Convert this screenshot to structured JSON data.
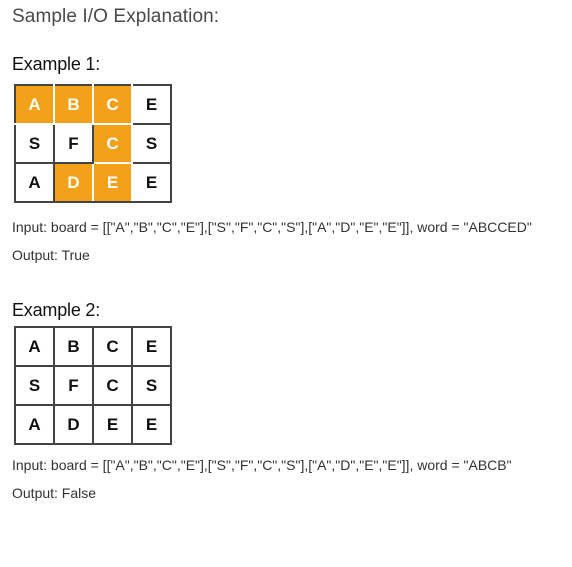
{
  "heading": "Sample I/O Explanation:",
  "examples": [
    {
      "title": "Example 1:",
      "board": [
        [
          "A",
          "B",
          "C",
          "E"
        ],
        [
          "S",
          "F",
          "C",
          "S"
        ],
        [
          "A",
          "D",
          "E",
          "E"
        ]
      ],
      "highlighted": [
        [
          0,
          0
        ],
        [
          0,
          1
        ],
        [
          0,
          2
        ],
        [
          1,
          2
        ],
        [
          2,
          1
        ],
        [
          2,
          2
        ]
      ],
      "highlight_color": "#f4a11a",
      "input": "Input: board = [[\"A\",\"B\",\"C\",\"E\"],[\"S\",\"F\",\"C\",\"S\"],[\"A\",\"D\",\"E\",\"E\"]], word = \"ABCCED\"",
      "output": "Output: True"
    },
    {
      "title": "Example 2:",
      "board": [
        [
          "A",
          "B",
          "C",
          "E"
        ],
        [
          "S",
          "F",
          "C",
          "S"
        ],
        [
          "A",
          "D",
          "E",
          "E"
        ]
      ],
      "highlighted": [],
      "input": "Input: board = [[\"A\",\"B\",\"C\",\"E\"],[\"S\",\"F\",\"C\",\"S\"],[\"A\",\"D\",\"E\",\"E\"]], word = \"ABCB\"",
      "output": "Output: False"
    }
  ]
}
